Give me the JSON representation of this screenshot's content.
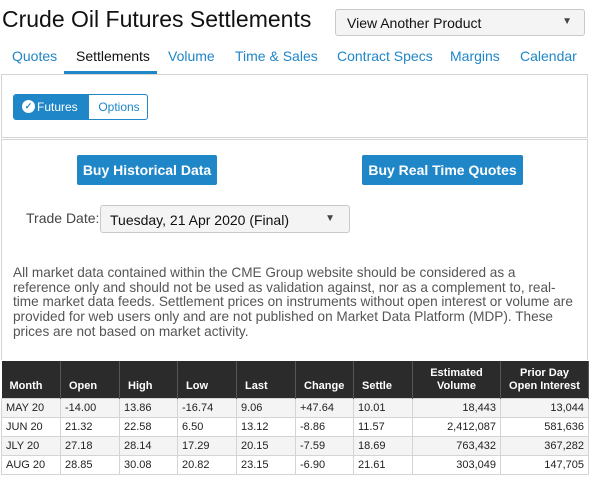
{
  "header": {
    "title": "Crude Oil Futures Settlements",
    "product_select_label": "View Another Product"
  },
  "tabs": [
    {
      "label": "Quotes",
      "active": false
    },
    {
      "label": "Settlements",
      "active": true
    },
    {
      "label": "Volume",
      "active": false
    },
    {
      "label": "Time & Sales",
      "active": false
    },
    {
      "label": "Contract Specs",
      "active": false
    },
    {
      "label": "Margins",
      "active": false
    },
    {
      "label": "Calendar",
      "active": false
    }
  ],
  "toggle": {
    "futures": "Futures",
    "options": "Options",
    "selected": "Futures"
  },
  "buttons": {
    "historical": "Buy Historical Data",
    "realtime": "Buy Real Time Quotes"
  },
  "trade_date": {
    "label": "Trade Date:",
    "value": "Tuesday, 21 Apr 2020 (Final)"
  },
  "disclaimer": "All market data contained within the CME Group website should be considered as a reference only and should not be used as validation against, nor as a complement to, real-time market data feeds. Settlement prices on instruments without open interest or volume are provided for web users only and are not published on Market Data Platform (MDP). These prices are not based on market activity.",
  "table": {
    "headers": [
      "Month",
      "Open",
      "High",
      "Low",
      "Last",
      "Change",
      "Settle",
      "Estimated Volume",
      "Prior Day Open Interest"
    ],
    "rows": [
      [
        "MAY 20",
        "-14.00",
        "13.86",
        "-16.74",
        "9.06",
        "+47.64",
        "10.01",
        "18,443",
        "13,044"
      ],
      [
        "JUN 20",
        "21.32",
        "22.58",
        "6.50",
        "13.12",
        "-8.86",
        "11.57",
        "2,412,087",
        "581,636"
      ],
      [
        "JLY 20",
        "27.18",
        "28.14",
        "17.29",
        "20.15",
        "-7.59",
        "18.69",
        "763,432",
        "367,282"
      ],
      [
        "AUG 20",
        "28.85",
        "30.08",
        "20.82",
        "23.15",
        "-6.90",
        "21.61",
        "303,049",
        "147,705"
      ]
    ]
  },
  "colors": {
    "accent": "#1f86c8",
    "table_header": "#2b2b2b"
  }
}
